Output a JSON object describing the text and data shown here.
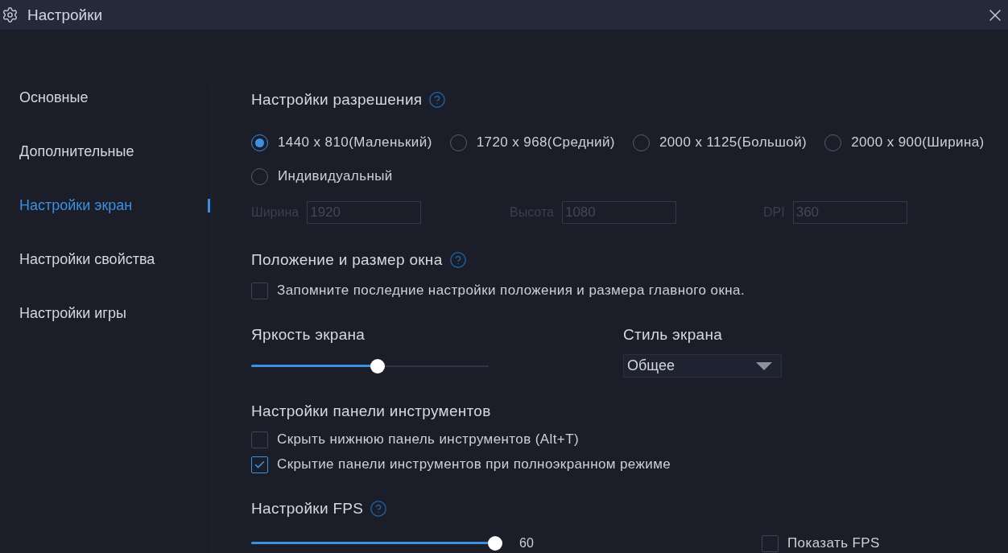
{
  "window": {
    "title": "Настройки"
  },
  "sidebar": {
    "items": [
      {
        "label": "Основные",
        "selected": false
      },
      {
        "label": "Дополнительные",
        "selected": false
      },
      {
        "label": "Настройки экран",
        "selected": true
      },
      {
        "label": "Настройки свойства",
        "selected": false
      },
      {
        "label": "Настройки игры",
        "selected": false
      }
    ]
  },
  "resolution": {
    "title": "Настройки разрешения",
    "options": [
      {
        "label": "1440 x 810(Маленький)",
        "selected": true
      },
      {
        "label": "1720 x 968(Средний)",
        "selected": false
      },
      {
        "label": "2000 x 1125(Большой)",
        "selected": false
      },
      {
        "label": "2000 x 900(Ширина)",
        "selected": false
      },
      {
        "label": "Индивидуальный",
        "selected": false
      }
    ],
    "fields": [
      {
        "label": "Ширина",
        "value": "1920",
        "disabled": true
      },
      {
        "label": "Высота",
        "value": "1080",
        "disabled": true
      },
      {
        "label": "DPI",
        "value": "360",
        "disabled": true
      }
    ]
  },
  "window_position": {
    "title": "Положение и размер окна",
    "checkbox": {
      "label": "Запомните последние настройки положения и размера главного окна.",
      "checked": false
    }
  },
  "brightness": {
    "title": "Яркость экрана",
    "level": 0.5
  },
  "screen_style": {
    "title": "Стиль экрана",
    "value": "Общее"
  },
  "toolbar": {
    "title": "Настройки панели инструментов",
    "options": [
      {
        "label": "Скрыть нижнюю панель инструментов (Alt+T)",
        "checked": false
      },
      {
        "label": "Скрытие панели инструментов при полноэкранном режиме",
        "checked": true
      }
    ]
  },
  "fps": {
    "title": "Настройки FPS",
    "level": 1,
    "reading": "60",
    "show_fps": {
      "label": "Показать FPS",
      "checked": false
    }
  }
}
